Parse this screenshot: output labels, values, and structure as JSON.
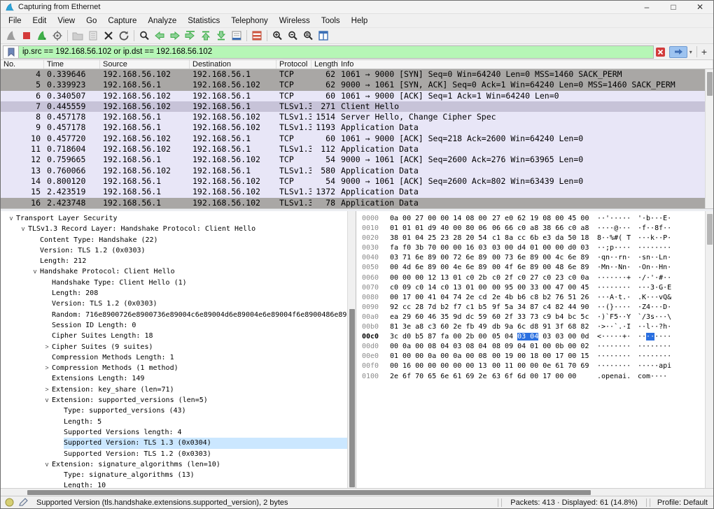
{
  "window": {
    "title": "Capturing from Ethernet",
    "minimize": "–",
    "maximize": "□",
    "close": "✕"
  },
  "menu": [
    "File",
    "Edit",
    "View",
    "Go",
    "Capture",
    "Analyze",
    "Statistics",
    "Telephony",
    "Wireless",
    "Tools",
    "Help"
  ],
  "toolbar": {
    "icons": [
      "start-capture",
      "stop-capture",
      "restart-capture",
      "capture-options",
      "open-file",
      "save-file",
      "close-file",
      "reload",
      "find-packet",
      "previous-packet",
      "next-packet",
      "go-to-packet",
      "first-packet",
      "last-packet",
      "auto-scroll",
      "colorize-packets",
      "zoom-in",
      "zoom-out",
      "zoom-original",
      "resize-columns"
    ]
  },
  "filter": {
    "value": "ip.src == 192.168.56.102 or ip.dst == 192.168.56.102",
    "valid_color": "#b6f6b6"
  },
  "packet_list": {
    "columns": [
      "No.",
      "Time",
      "Source",
      "Destination",
      "Protocol",
      "Length",
      "Info"
    ],
    "rows": [
      {
        "no": "4",
        "time": "0.339646",
        "src": "192.168.56.102",
        "dst": "192.168.56.1",
        "proto": "TCP",
        "len": "62",
        "info": "1061 → 9000 [SYN] Seq=0 Win=64240 Len=0 MSS=1460 SACK_PERM",
        "style": "row-gray"
      },
      {
        "no": "5",
        "time": "0.339923",
        "src": "192.168.56.1",
        "dst": "192.168.56.102",
        "proto": "TCP",
        "len": "62",
        "info": "9000 → 1061 [SYN, ACK] Seq=0 Ack=1 Win=64240 Len=0 MSS=1460 SACK_PERM",
        "style": "row-gray"
      },
      {
        "no": "6",
        "time": "0.340507",
        "src": "192.168.56.102",
        "dst": "192.168.56.1",
        "proto": "TCP",
        "len": "60",
        "info": "1061 → 9000 [ACK] Seq=1 Ack=1 Win=64240 Len=0",
        "style": "row-lav"
      },
      {
        "no": "7",
        "time": "0.445559",
        "src": "192.168.56.102",
        "dst": "192.168.56.1",
        "proto": "TLSv1.3",
        "len": "271",
        "info": "Client Hello",
        "style": "row-sel"
      },
      {
        "no": "8",
        "time": "0.457178",
        "src": "192.168.56.1",
        "dst": "192.168.56.102",
        "proto": "TLSv1.3",
        "len": "1514",
        "info": "Server Hello, Change Cipher Spec",
        "style": "row-lav"
      },
      {
        "no": "9",
        "time": "0.457178",
        "src": "192.168.56.1",
        "dst": "192.168.56.102",
        "proto": "TLSv1.3",
        "len": "1193",
        "info": "Application Data",
        "style": "row-lav"
      },
      {
        "no": "10",
        "time": "0.457720",
        "src": "192.168.56.102",
        "dst": "192.168.56.1",
        "proto": "TCP",
        "len": "60",
        "info": "1061 → 9000 [ACK] Seq=218 Ack=2600 Win=64240 Len=0",
        "style": "row-lav"
      },
      {
        "no": "11",
        "time": "0.718604",
        "src": "192.168.56.102",
        "dst": "192.168.56.1",
        "proto": "TLSv1.3",
        "len": "112",
        "info": "Application Data",
        "style": "row-lav"
      },
      {
        "no": "12",
        "time": "0.759665",
        "src": "192.168.56.1",
        "dst": "192.168.56.102",
        "proto": "TCP",
        "len": "54",
        "info": "9000 → 1061 [ACK] Seq=2600 Ack=276 Win=63965 Len=0",
        "style": "row-lav"
      },
      {
        "no": "13",
        "time": "0.760066",
        "src": "192.168.56.102",
        "dst": "192.168.56.1",
        "proto": "TLSv1.3",
        "len": "580",
        "info": "Application Data",
        "style": "row-lav"
      },
      {
        "no": "14",
        "time": "0.800120",
        "src": "192.168.56.1",
        "dst": "192.168.56.102",
        "proto": "TCP",
        "len": "54",
        "info": "9000 → 1061 [ACK] Seq=2600 Ack=802 Win=63439 Len=0",
        "style": "row-lav"
      },
      {
        "no": "15",
        "time": "2.423519",
        "src": "192.168.56.1",
        "dst": "192.168.56.102",
        "proto": "TLSv1.3",
        "len": "1372",
        "info": "Application Data",
        "style": "row-lav"
      },
      {
        "no": "16",
        "time": "2.423748",
        "src": "192.168.56.1",
        "dst": "192.168.56.102",
        "proto": "TLSv1.3",
        "len": "78",
        "info": "Application Data",
        "style": "row-gray"
      }
    ]
  },
  "details": {
    "lines": [
      {
        "indent": 0,
        "twisty": "v",
        "text": "Transport Layer Security"
      },
      {
        "indent": 1,
        "twisty": "v",
        "text": "TLSv1.3 Record Layer: Handshake Protocol: Client Hello"
      },
      {
        "indent": 2,
        "twisty": "",
        "text": "Content Type: Handshake (22)"
      },
      {
        "indent": 2,
        "twisty": "",
        "text": "Version: TLS 1.2 (0x0303)"
      },
      {
        "indent": 2,
        "twisty": "",
        "text": "Length: 212"
      },
      {
        "indent": 2,
        "twisty": "v",
        "text": "Handshake Protocol: Client Hello"
      },
      {
        "indent": 3,
        "twisty": "",
        "text": "Handshake Type: Client Hello (1)"
      },
      {
        "indent": 3,
        "twisty": "",
        "text": "Length: 208"
      },
      {
        "indent": 3,
        "twisty": "",
        "text": "Version: TLS 1.2 (0x0303)"
      },
      {
        "indent": 3,
        "twisty": "",
        "text": "Random: 716e8900726e8900736e89004c6e89004d6e89004e6e89004f6e8900486e89"
      },
      {
        "indent": 3,
        "twisty": "",
        "text": "Session ID Length: 0"
      },
      {
        "indent": 3,
        "twisty": "",
        "text": "Cipher Suites Length: 18"
      },
      {
        "indent": 3,
        "twisty": ">",
        "text": "Cipher Suites (9 suites)"
      },
      {
        "indent": 3,
        "twisty": "",
        "text": "Compression Methods Length: 1"
      },
      {
        "indent": 3,
        "twisty": ">",
        "text": "Compression Methods (1 method)"
      },
      {
        "indent": 3,
        "twisty": "",
        "text": "Extensions Length: 149"
      },
      {
        "indent": 3,
        "twisty": ">",
        "text": "Extension: key_share (len=71)"
      },
      {
        "indent": 3,
        "twisty": "v",
        "text": "Extension: supported_versions (len=5)"
      },
      {
        "indent": 4,
        "twisty": "",
        "text": "Type: supported_versions (43)"
      },
      {
        "indent": 4,
        "twisty": "",
        "text": "Length: 5"
      },
      {
        "indent": 4,
        "twisty": "",
        "text": "Supported Versions length: 4"
      },
      {
        "indent": 4,
        "twisty": "",
        "text": "Supported Version: TLS 1.3 (0x0304)",
        "hl": true
      },
      {
        "indent": 4,
        "twisty": "",
        "text": "Supported Version: TLS 1.2 (0x0303)"
      },
      {
        "indent": 3,
        "twisty": "v",
        "text": "Extension: signature_algorithms (len=10)"
      },
      {
        "indent": 4,
        "twisty": "",
        "text": "Type: signature_algorithms (13)"
      },
      {
        "indent": 4,
        "twisty": "",
        "text": "Length: 10"
      }
    ]
  },
  "hex": {
    "rows": [
      {
        "o": "0000",
        "h1": "0a 00 27 00 00 14 08 00",
        "h2": "27 e0 62 19 08 00 45 00",
        "a1": "··'·····",
        "a2": "'·b···E·"
      },
      {
        "o": "0010",
        "h1": "01 01 01 d9 40 00 80 06",
        "h2": "06 66 c0 a8 38 66 c0 a8",
        "a1": "····@···",
        "a2": "·f··8f··"
      },
      {
        "o": "0020",
        "h1": "38 01 04 25 23 28 20 54",
        "h2": "c1 8a cc 6b e3 da 50 18",
        "a1": "8··%#( T",
        "a2": "···k··P·"
      },
      {
        "o": "0030",
        "h1": "fa f0 3b 70 00 00 16 03",
        "h2": "03 00 d4 01 00 00 d0 03",
        "a1": "··;p····",
        "a2": "········"
      },
      {
        "o": "0040",
        "h1": "03 71 6e 89 00 72 6e 89",
        "h2": "00 73 6e 89 00 4c 6e 89",
        "a1": "·qn··rn·",
        "a2": "·sn··Ln·"
      },
      {
        "o": "0050",
        "h1": "00 4d 6e 89 00 4e 6e 89",
        "h2": "00 4f 6e 89 00 48 6e 89",
        "a1": "·Mn··Nn·",
        "a2": "·On··Hn·"
      },
      {
        "o": "0060",
        "h1": "00 00 00 12 13 01 c0 2b",
        "h2": "c0 2f c0 27 c0 23 c0 0a",
        "a1": "·······+",
        "a2": "·/·'·#··"
      },
      {
        "o": "0070",
        "h1": "c0 09 c0 14 c0 13 01 00",
        "h2": "00 95 00 33 00 47 00 45",
        "a1": "········",
        "a2": "···3·G·E"
      },
      {
        "o": "0080",
        "h1": "00 17 00 41 04 74 2e cd",
        "h2": "2e 4b b6 c8 b2 76 51 26",
        "a1": "···A·t.·",
        "a2": ".K···vQ&"
      },
      {
        "o": "0090",
        "h1": "92 cc 28 7d b2 f7 c1 b5",
        "h2": "9f 5a 34 87 c4 82 44 90",
        "a1": "··(}····",
        "a2": "·Z4···D·"
      },
      {
        "o": "00a0",
        "h1": "ea 29 60 46 35 9d dc 59",
        "h2": "60 2f 33 73 c9 b4 bc 5c",
        "a1": "·)`F5··Y",
        "a2": "`/3s···\\"
      },
      {
        "o": "00b0",
        "h1": "81 3e a8 c3 60 2e fb 49",
        "h2": "db 9a 6c d8 91 3f 68 82",
        "a1": "·>··`.·I",
        "a2": "··l··?h·"
      },
      {
        "o": "00c0",
        "h1": "3c d0 b5 87 fa 00 2b 00",
        "h2": "05 04 03 04 03 03 00 0d",
        "a1": "<·····+·",
        "a2": "········",
        "bold": true,
        "hl": {
          "h2": [
            6,
            11
          ],
          "a2": [
            2,
            4
          ]
        }
      },
      {
        "o": "00d0",
        "h1": "00 0a 00 08 04 03 08 04",
        "h2": "08 09 04 01 00 0b 00 02",
        "a1": "········",
        "a2": "········"
      },
      {
        "o": "00e0",
        "h1": "01 00 00 0a 00 0a 00 08",
        "h2": "00 19 00 18 00 17 00 15",
        "a1": "········",
        "a2": "········"
      },
      {
        "o": "00f0",
        "h1": "00 16 00 00 00 00 00 13",
        "h2": "00 11 00 00 0e 61 70 69",
        "a1": "········",
        "a2": "·····api"
      },
      {
        "o": "0100",
        "h1": "2e 6f 70 65 6e 61 69 2e",
        "h2": "63 6f 6d 00 17 00 00",
        "a1": ".openai.",
        "a2": "com····"
      }
    ]
  },
  "status": {
    "field_info": "Supported Version (tls.handshake.extensions.supported_version), 2 bytes",
    "packets": "Packets: 413 · Displayed: 61 (14.8%)",
    "profile": "Profile: Default"
  }
}
